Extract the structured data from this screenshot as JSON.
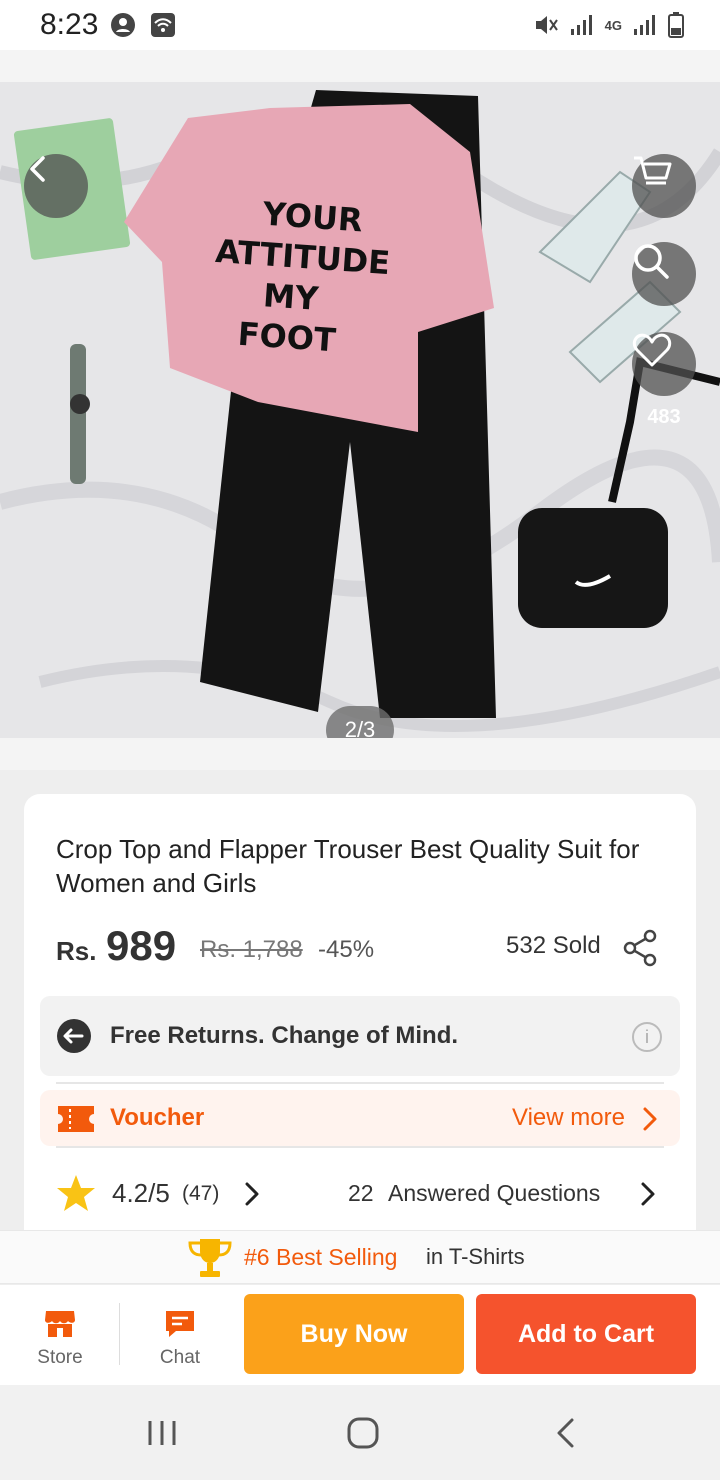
{
  "status_bar": {
    "time": "8:23",
    "network": "4G"
  },
  "hero": {
    "pager": "2/3",
    "favorite_count": "483",
    "printed_shirt_text": [
      "YOUR",
      "ATTITUDE",
      "MY",
      "FOOT"
    ]
  },
  "product": {
    "title": "Crop Top and Flapper Trouser Best Quality Suit for Women and Girls",
    "currency": "Rs.",
    "price": "989",
    "original_price": "Rs. 1,788",
    "discount": "-45%",
    "sold": "532 Sold"
  },
  "returns": {
    "text": "Free Returns. Change of Mind.",
    "info": "i"
  },
  "voucher": {
    "label": "Voucher",
    "link": "View more"
  },
  "rating": {
    "value": "4.2/5",
    "count": "(47)",
    "questions_count": "22",
    "questions_label": "Answered Questions"
  },
  "best_selling": {
    "rank": "#6 Best Selling",
    "category": "in T-Shirts"
  },
  "action_bar": {
    "store_label": "Store",
    "chat_label": "Chat",
    "buy_now": "Buy Now",
    "add_to_cart": "Add to Cart"
  },
  "colors": {
    "accent": "#f25a0c",
    "buy_now": "#fba11a",
    "add_to_cart": "#f5532d",
    "star": "#f9c315"
  }
}
